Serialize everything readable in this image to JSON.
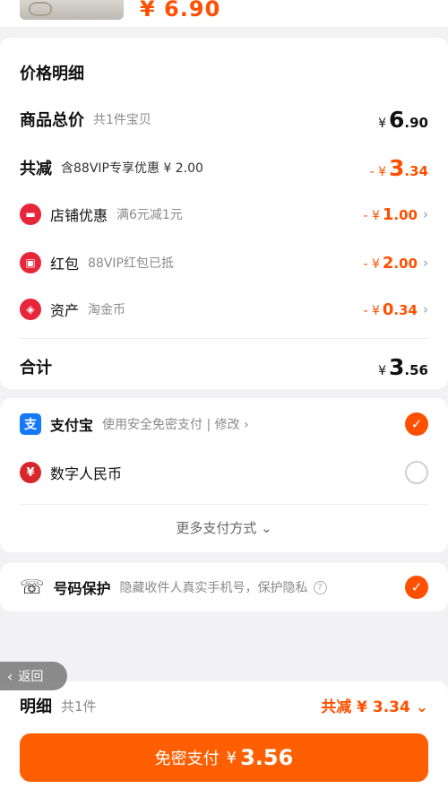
{
  "top": {
    "price": "¥ 6.90"
  },
  "price_detail": {
    "title": "价格明细",
    "goods_total": {
      "label": "商品总价",
      "sub": "共1件宝贝",
      "currency": "¥",
      "int": "6",
      "dec": ".90"
    },
    "total_discount": {
      "label": "共减",
      "sub": "含88VIP专享优惠 ¥ 2.00",
      "currency": "- ¥",
      "int": "3",
      "dec": ".34"
    },
    "items": [
      {
        "label": "店铺优惠",
        "sub": "满6元减1元",
        "currency": "- ¥",
        "int": "1",
        "dec": ".00",
        "icon": "store-icon"
      },
      {
        "label": "红包",
        "sub": "88VIP红包已抵",
        "currency": "- ¥",
        "int": "2",
        "dec": ".00",
        "icon": "red-packet-icon"
      },
      {
        "label": "资产",
        "sub": "淘金币",
        "currency": "- ¥",
        "int": "0",
        "dec": ".34",
        "icon": "coin-tag-icon"
      }
    ],
    "total": {
      "label": "合计",
      "currency": "¥",
      "int": "3",
      "dec": ".56"
    }
  },
  "payment": {
    "alipay": {
      "name": "支付宝",
      "desc": "使用安全免密支付 | 修改 ›",
      "selected": true
    },
    "ecny": {
      "name": "数字人民币",
      "selected": false
    },
    "more": "更多支付方式 ⌄"
  },
  "phone_protect": {
    "name": "号码保护",
    "desc": "隐藏收件人真实手机号，保护隐私",
    "help": "?"
  },
  "back": {
    "arrow": "‹",
    "label": "返回"
  },
  "bottom": {
    "detail": "明细",
    "count": "共1件",
    "saved": "共减 ¥ 3.34 ⌄",
    "pay_label": "免密支付",
    "pay_currency": "¥",
    "pay_amount": "3.56"
  },
  "colors": {
    "accent": "#ff5000",
    "alipay": "#1677ff",
    "red": "#e8263b"
  }
}
